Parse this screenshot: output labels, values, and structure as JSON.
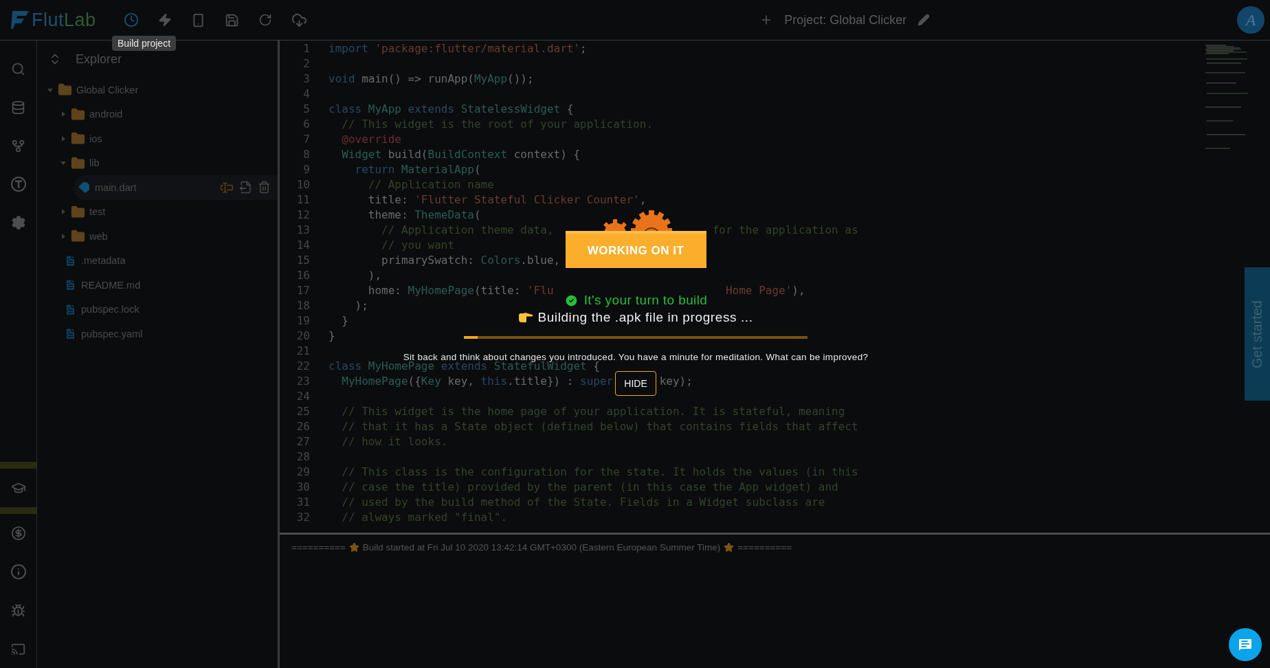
{
  "logo": {
    "parts": [
      "Flut",
      "Lab"
    ]
  },
  "tooltip": "Build project",
  "project": {
    "title": "Project: Global Clicker"
  },
  "avatar": {
    "letter": "A"
  },
  "explorer": {
    "title": "Explorer",
    "tree": [
      {
        "name": "Global Clicker",
        "kind": "folder",
        "expanded": true,
        "selected": false,
        "children": [
          {
            "name": "android",
            "kind": "folder",
            "expanded": false,
            "selected": false
          },
          {
            "name": "ios",
            "kind": "folder",
            "expanded": false,
            "selected": false
          },
          {
            "name": "lib",
            "kind": "folder",
            "expanded": true,
            "selected": false,
            "children": [
              {
                "name": "main.dart",
                "kind": "dart",
                "selected": true
              }
            ]
          },
          {
            "name": "test",
            "kind": "folder",
            "expanded": false,
            "selected": false
          },
          {
            "name": "web",
            "kind": "folder",
            "expanded": false,
            "selected": false
          },
          {
            "name": ".metadata",
            "kind": "file",
            "selected": false
          },
          {
            "name": "README.md",
            "kind": "file",
            "selected": false
          },
          {
            "name": "pubspec.lock",
            "kind": "file",
            "selected": false
          },
          {
            "name": "pubspec.yaml",
            "kind": "file",
            "selected": false
          }
        ]
      }
    ]
  },
  "code": [
    {
      "n": "1",
      "tokens": [
        {
          "kind": "kw",
          "text": "import"
        },
        {
          "kind": "str",
          "text": " 'package:flutter/material.dart'"
        },
        {
          "kind": "pl",
          "text": ";"
        }
      ]
    },
    {
      "n": "2"
    },
    {
      "n": "3",
      "tokens": [
        {
          "kind": "kw",
          "text": "void"
        },
        {
          "kind": "pl",
          "text": " main() => runApp("
        },
        {
          "kind": "ty",
          "text": "MyApp"
        },
        {
          "kind": "pl",
          "text": "());"
        }
      ]
    },
    {
      "n": "4"
    },
    {
      "n": "5",
      "tokens": [
        {
          "kind": "kw",
          "text": "class"
        },
        {
          "kind": "ty",
          "text": " MyApp"
        },
        {
          "kind": "kw",
          "text": " extends"
        },
        {
          "kind": "ty",
          "text": " StatelessWidget"
        },
        {
          "kind": "pl",
          "text": " {"
        }
      ]
    },
    {
      "n": "6",
      "tokens": [
        {
          "kind": "cm",
          "text": "  // This widget is the root of your application."
        }
      ]
    },
    {
      "n": "7",
      "tokens": [
        {
          "kind": "an",
          "text": "  @override"
        }
      ]
    },
    {
      "n": "8",
      "tokens": [
        {
          "kind": "ty",
          "text": "  Widget"
        },
        {
          "kind": "pl",
          "text": " build("
        },
        {
          "kind": "ty",
          "text": "BuildContext"
        },
        {
          "kind": "pl",
          "text": " context) {"
        }
      ]
    },
    {
      "n": "9",
      "tokens": [
        {
          "kind": "kw",
          "text": "    return"
        },
        {
          "kind": "ty",
          "text": " MaterialApp"
        },
        {
          "kind": "pl",
          "text": "("
        }
      ]
    },
    {
      "n": "10",
      "tokens": [
        {
          "kind": "cm",
          "text": "      // Application name"
        }
      ]
    },
    {
      "n": "11",
      "tokens": [
        {
          "kind": "pl",
          "text": "      title: "
        },
        {
          "kind": "str",
          "text": "'Flutter Stateful Clicker Counter'"
        },
        {
          "kind": "pl",
          "text": ","
        }
      ]
    },
    {
      "n": "12",
      "tokens": [
        {
          "kind": "pl",
          "text": "      theme: "
        },
        {
          "kind": "ty",
          "text": "ThemeData"
        },
        {
          "kind": "pl",
          "text": "("
        }
      ]
    },
    {
      "n": "13",
      "tokens": [
        {
          "kind": "cm",
          "text": "        // Application theme data,"
        }
      ],
      "after": {
        "kind": "picture",
        "tokens": [
          {
            "kind": "cm",
            "text": "for the application as"
          }
        ]
      }
    },
    {
      "n": "14",
      "tokens": [
        {
          "kind": "cm",
          "text": "        // you want"
        }
      ]
    },
    {
      "n": "15",
      "tokens": [
        {
          "kind": "pl",
          "text": "        primarySwatch: "
        },
        {
          "kind": "ty",
          "text": "Colors"
        },
        {
          "kind": "pl",
          "text": ".blue,"
        }
      ]
    },
    {
      "n": "16",
      "tokens": [
        {
          "kind": "pl",
          "text": "      ),"
        }
      ]
    },
    {
      "n": "17",
      "tokens": [
        {
          "kind": "pl",
          "text": "      home: "
        },
        {
          "kind": "ty",
          "text": "MyHomePage"
        },
        {
          "kind": "pl",
          "text": "(title: "
        },
        {
          "kind": "str",
          "text": "'Flu"
        }
      ],
      "after": {
        "kind": "status",
        "tokens": [
          {
            "kind": "str",
            "text": "Home Page'"
          },
          {
            "kind": "pl",
            "text": "),"
          }
        ]
      }
    },
    {
      "n": "18",
      "tokens": [
        {
          "kind": "pl",
          "text": "    );"
        }
      ]
    },
    {
      "n": "19",
      "tokens": [
        {
          "kind": "pl",
          "text": "  }"
        }
      ]
    },
    {
      "n": "20",
      "tokens": [
        {
          "kind": "pl",
          "text": "}"
        }
      ]
    },
    {
      "n": "21"
    },
    {
      "n": "22",
      "tokens": [
        {
          "kind": "kw",
          "text": "class"
        },
        {
          "kind": "ty",
          "text": " MyHomePage"
        },
        {
          "kind": "kw",
          "text": " extends"
        },
        {
          "kind": "ty",
          "text": " StatefulWidget"
        },
        {
          "kind": "pl",
          "text": " {"
        }
      ]
    },
    {
      "n": "23",
      "tokens": [
        {
          "kind": "ty",
          "text": "  MyHomePage"
        },
        {
          "kind": "pl",
          "text": "({"
        },
        {
          "kind": "ty",
          "text": "Key"
        },
        {
          "kind": "pl",
          "text": " key, "
        },
        {
          "kind": "kw",
          "text": "this"
        },
        {
          "kind": "pl",
          "text": ".title}) : "
        },
        {
          "kind": "kw",
          "text": "super"
        }
      ],
      "after": {
        "kind": "button",
        "tokens": [
          {
            "kind": "pl",
            "text": "key);"
          }
        ]
      }
    },
    {
      "n": "24"
    },
    {
      "n": "25",
      "tokens": [
        {
          "kind": "cm",
          "text": "  // This widget is the home page of your application. It is stateful, meaning"
        }
      ]
    },
    {
      "n": "26",
      "tokens": [
        {
          "kind": "cm",
          "text": "  // that it has a State object (defined below) that contains fields that affect"
        }
      ]
    },
    {
      "n": "27",
      "tokens": [
        {
          "kind": "cm",
          "text": "  // how it looks."
        }
      ]
    },
    {
      "n": "28"
    },
    {
      "n": "29",
      "tokens": [
        {
          "kind": "cm",
          "text": "  // This class is the configuration for the state. It holds the values (in this"
        }
      ]
    },
    {
      "n": "30",
      "tokens": [
        {
          "kind": "cm",
          "text": "  // case the title) provided by the parent (in this case the App widget) and"
        }
      ]
    },
    {
      "n": "31",
      "tokens": [
        {
          "kind": "cm",
          "text": "  // used by the build method of the State. Fields in a Widget subclass are"
        }
      ]
    },
    {
      "n": "32",
      "tokens": [
        {
          "kind": "cm",
          "text": "  // always marked \"final\"."
        }
      ]
    }
  ],
  "output": {
    "rule_left": "==========",
    "message": "Build started at Fri Jul 10 2020 13:42:14 GMT+0300 (Eastern European Summer Time)",
    "rule_right": "=========="
  },
  "build_dialog": {
    "banner": "WORKING ON IT",
    "status": "It's your turn to build",
    "progress_text": "Building the .apk file in progress ...",
    "progress": {
      "level": 0.04
    },
    "message": "Sit back and think about changes you introduced. You have a minute for meditation. What can be improved?",
    "hide_button": "HIDE"
  },
  "get_started": "Get started"
}
